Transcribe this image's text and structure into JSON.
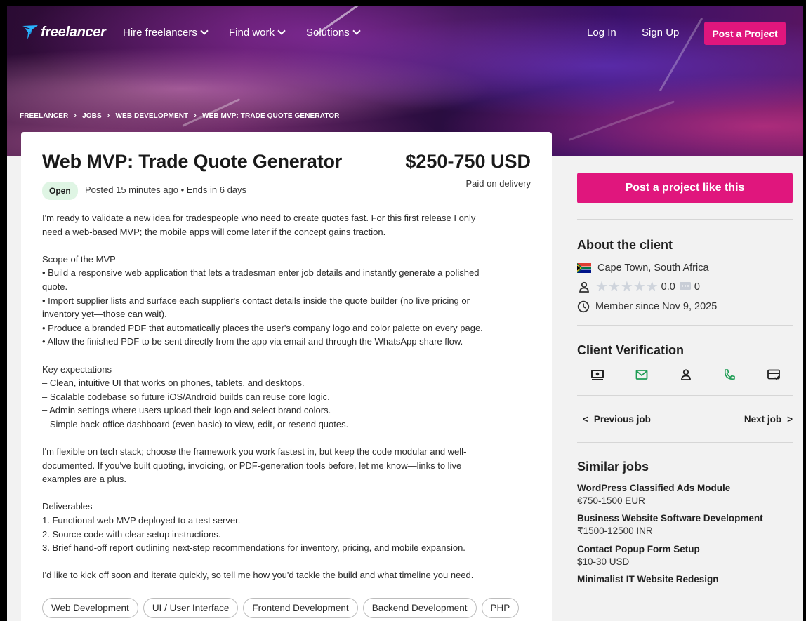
{
  "nav": {
    "logo": "freelancer",
    "hire": "Hire freelancers",
    "find": "Find work",
    "solutions": "Solutions",
    "login": "Log In",
    "signup": "Sign Up",
    "post_project": "Post a Project"
  },
  "breadcrumb": [
    "FREELANCER",
    "JOBS",
    "WEB DEVELOPMENT",
    "WEB MVP: TRADE QUOTE GENERATOR"
  ],
  "job": {
    "title": "Web MVP: Trade Quote Generator",
    "budget": "$250-750 USD",
    "paid": "Paid on delivery",
    "status": "Open",
    "posted": "Posted 15 minutes ago • Ends in 6 days",
    "description": [
      "I'm ready to validate a new idea for tradespeople who need to create quotes fast. For this first release I only\nneed a web-based MVP; the mobile apps will come later if the concept gains traction.",
      "Scope of the MVP\n• Build a responsive web application that lets a tradesman enter job details and instantly generate a polished\nquote.\n• Import supplier lists and surface each supplier's contact details inside the quote builder (no live pricing or\ninventory yet—those can wait).\n• Produce a branded PDF that automatically places the user's company logo and color palette on every page.\n• Allow the finished PDF to be sent directly from the app via email and through the WhatsApp share flow.",
      "Key expectations\n– Clean, intuitive UI that works on phones, tablets, and desktops.\n– Scalable codebase so future iOS/Android builds can reuse core logic.\n– Admin settings where users upload their logo and select brand colors.\n– Simple back-office dashboard (even basic) to view, edit, or resend quotes.",
      "I'm flexible on tech stack; choose the framework you work fastest in, but keep the code modular and well-\ndocumented. If you've built quoting, invoicing, or PDF-generation tools before, let me know—links to live\nexamples are a plus.",
      "Deliverables\n1. Functional web MVP deployed to a test server.\n2. Source code with clear setup instructions.\n3. Brief hand-off report outlining next-step recommendations for inventory, pricing, and mobile expansion.",
      "I'd like to kick off soon and iterate quickly, so tell me how you'd tackle the build and what timeline you need."
    ],
    "tags": [
      "Web Development",
      "UI / User Interface",
      "Frontend Development",
      "Backend Development",
      "PHP"
    ]
  },
  "sidebar": {
    "post_like": "Post a project like this",
    "about_heading": "About the client",
    "location": "Cape Town, South Africa",
    "rating": "0.0",
    "reviews": "0",
    "member_since": "Member since Nov 9, 2025",
    "verification_heading": "Client Verification",
    "prev_job": "Previous job",
    "next_job": "Next job",
    "similar_heading": "Similar jobs",
    "similar": [
      {
        "title": "WordPress Classified Ads Module",
        "price": "€750-1500 EUR"
      },
      {
        "title": "Business Website Software Development",
        "price": "₹1500-12500 INR"
      },
      {
        "title": "Contact Popup Form Setup",
        "price": "$10-30 USD"
      },
      {
        "title": "Minimalist IT Website Redesign",
        "price": ""
      }
    ]
  },
  "colors": {
    "accent": "#e0167d",
    "open_badge": "#dff5e4",
    "verified": "#1f9d55"
  },
  "icons": [
    "freelancer-bird-icon",
    "south-africa-flag-icon",
    "user-icon",
    "star-icon",
    "comment-icon",
    "clock-icon",
    "payment-icon",
    "email-icon",
    "phone-icon",
    "card-icon",
    "chevron-left-icon",
    "chevron-right-icon"
  ]
}
